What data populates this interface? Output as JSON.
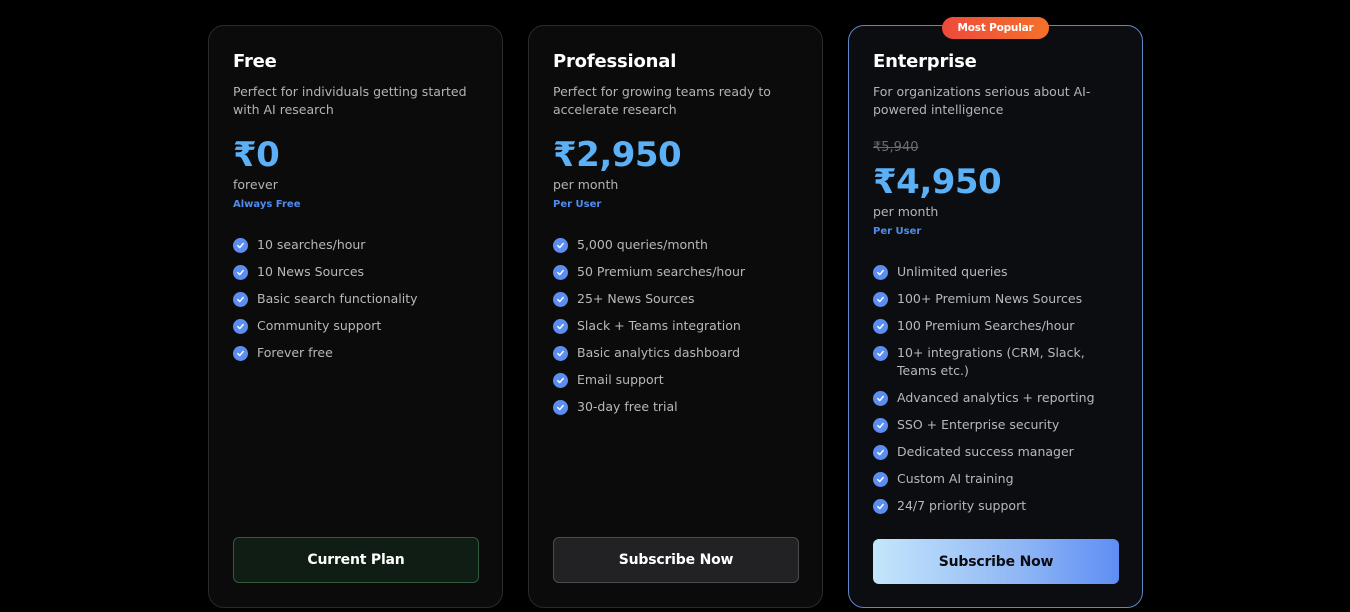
{
  "plans": [
    {
      "name": "Free",
      "description": "Perfect for individuals getting started with AI research",
      "old_price": "",
      "price": "₹0",
      "period": "forever",
      "note": "Always Free",
      "features": [
        "10 searches/hour",
        "10 News Sources",
        "Basic search functionality",
        "Community support",
        "Forever free"
      ],
      "button_label": "Current Plan"
    },
    {
      "name": "Professional",
      "description": "Perfect for growing teams ready to accelerate research",
      "old_price": "",
      "price": "₹2,950",
      "period": "per month",
      "note": "Per User",
      "features": [
        "5,000 queries/month",
        "50 Premium searches/hour",
        "25+ News Sources",
        "Slack + Teams integration",
        "Basic analytics dashboard",
        "Email support",
        "30-day free trial"
      ],
      "button_label": "Subscribe Now"
    },
    {
      "name": "Enterprise",
      "badge": "Most Popular",
      "description": "For organizations serious about AI-powered intelligence",
      "old_price": "₹5,940",
      "price": "₹4,950",
      "period": "per month",
      "note": "Per User",
      "features": [
        "Unlimited queries",
        "100+ Premium News Sources",
        "100 Premium Searches/hour",
        "10+ integrations (CRM, Slack, Teams etc.)",
        "Advanced analytics + reporting",
        "SSO + Enterprise security",
        "Dedicated success manager",
        "Custom AI training",
        "24/7 priority support"
      ],
      "button_label": "Subscribe Now"
    }
  ],
  "icons": {
    "feature_check": "check-circle-icon"
  },
  "colors": {
    "background": "#000000",
    "card": "#0b0b0c",
    "price_accent": "#5bb0f6",
    "note_accent": "#4f8cf0",
    "check": "#5b8ef0",
    "badge": "#ee4a3c",
    "highlight_border": "#5f86c8"
  }
}
